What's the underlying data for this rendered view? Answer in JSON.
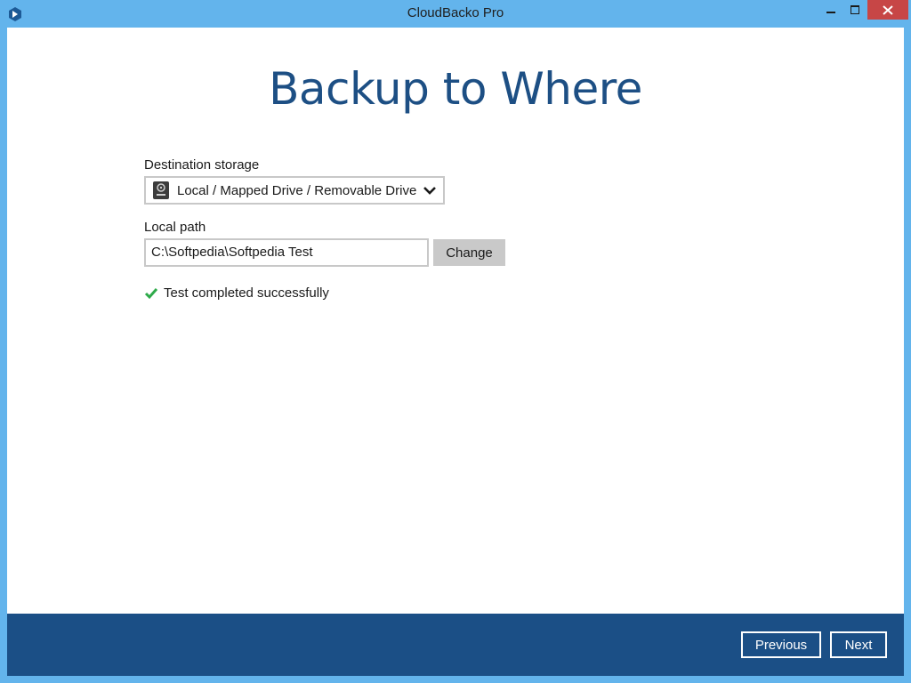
{
  "window": {
    "title": "CloudBacko Pro",
    "icons": {
      "app": "cloudbacko-app-icon",
      "minimize": "minimize-icon",
      "maximize": "maximize-icon",
      "close": "close-icon"
    }
  },
  "page": {
    "heading": "Backup to Where"
  },
  "destination": {
    "label": "Destination storage",
    "selected": "Local / Mapped Drive / Removable Drive",
    "icon": "drive-icon"
  },
  "local_path": {
    "label": "Local path",
    "value": "C:\\Softpedia\\Softpedia Test",
    "change_label": "Change"
  },
  "status": {
    "text": "Test completed successfully",
    "color": "#2eaa4a"
  },
  "footer": {
    "previous_label": "Previous",
    "next_label": "Next",
    "background": "#1b4f86"
  },
  "colors": {
    "accent": "#1d4f84",
    "frame": "#63b4ec"
  }
}
